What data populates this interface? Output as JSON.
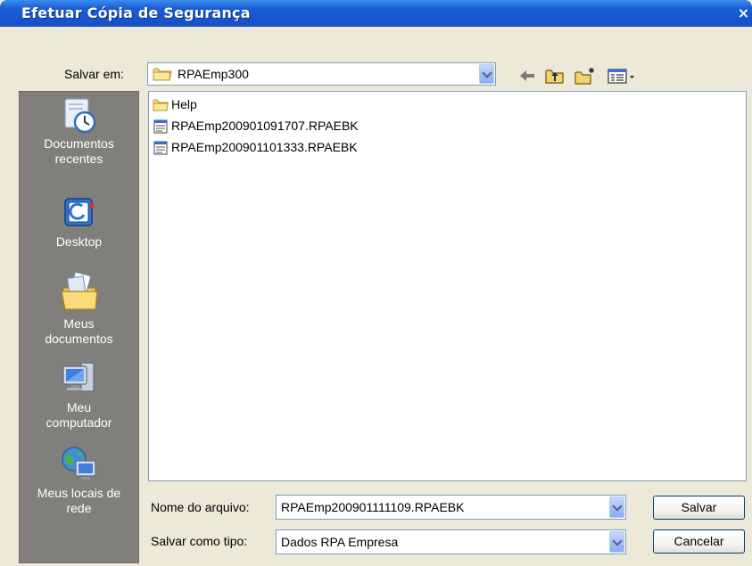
{
  "window": {
    "title": "Efetuar Cópia de Segurança",
    "close_glyph": "×"
  },
  "save_in": {
    "label": "Salvar em:",
    "value": "RPAEmp300",
    "icon": "folder-icon"
  },
  "toolbar": {
    "icons": [
      "back-arrow-icon",
      "up-one-level-icon",
      "new-folder-icon",
      "view-menu-icon"
    ],
    "back_glyph": "⇦"
  },
  "places": [
    {
      "label": "Documentos\nrecentes",
      "icon": "recent-documents-icon"
    },
    {
      "label": "Desktop",
      "icon": "desktop-icon"
    },
    {
      "label": "Meus\ndocumentos",
      "icon": "my-documents-icon"
    },
    {
      "label": "Meu\ncomputador",
      "icon": "my-computer-icon"
    },
    {
      "label": "Meus locais de\nrede",
      "icon": "network-places-icon"
    }
  ],
  "files": [
    {
      "name": "Help",
      "type": "folder"
    },
    {
      "name": "RPAEmp200901091707.RPAEBK",
      "type": "file"
    },
    {
      "name": "RPAEmp200901101333.RPAEBK",
      "type": "file"
    }
  ],
  "filename": {
    "label": "Nome do arquivo:",
    "value": "RPAEmp200901111109.RPAEBK"
  },
  "filetype": {
    "label": "Salvar como tipo:",
    "value": "Dados RPA Empresa"
  },
  "buttons": {
    "save": "Salvar",
    "cancel": "Cancelar"
  },
  "colors": {
    "titlebar": "#1656cf",
    "places_bg": "#807f7b",
    "dialog_bg": "#ece9d8",
    "field_border": "#7f9db9"
  }
}
